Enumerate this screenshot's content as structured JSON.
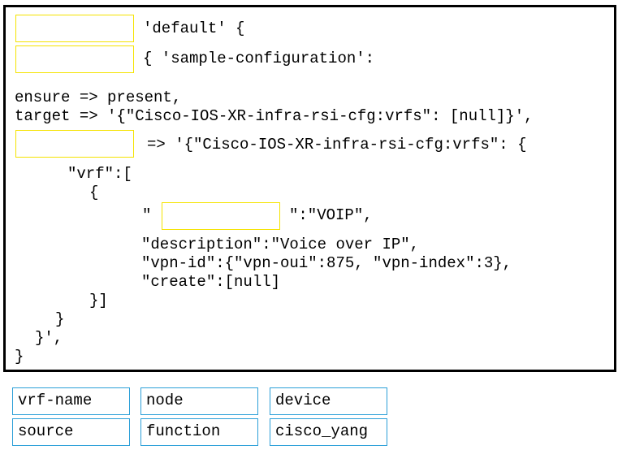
{
  "code": {
    "line1_suffix": "'default' {",
    "line2_suffix": "{ 'sample-configuration':",
    "ensure_line": "ensure => present,",
    "target_line": "target => '{\"Cisco-IOS-XR-infra-rsi-cfg:vrfs\": [null]}',",
    "line5_suffix": "=> '{\"Cisco-IOS-XR-infra-rsi-cfg:vrfs\": {",
    "vrf_open": "\"vrf\":[",
    "brace_open": "{",
    "name_prefix": "\"",
    "name_suffix": "\":\"VOIP\",",
    "description_line": "\"description\":\"Voice over IP\",",
    "vpn_id_line": "\"vpn-id\":{\"vpn-oui\":875, \"vpn-index\":3},",
    "create_line": "\"create\":[null]",
    "close_list": "}]",
    "close_brace1": "}",
    "close_quote": "}',",
    "close_brace_final": "}"
  },
  "answer_options": [
    {
      "label": "vrf-name"
    },
    {
      "label": "node"
    },
    {
      "label": "device"
    },
    {
      "label": "source"
    },
    {
      "label": "function"
    },
    {
      "label": "cisco_yang"
    }
  ],
  "colors": {
    "slot_border": "#f5e300",
    "option_border": "#2b9fd8",
    "frame_border": "#000000"
  }
}
